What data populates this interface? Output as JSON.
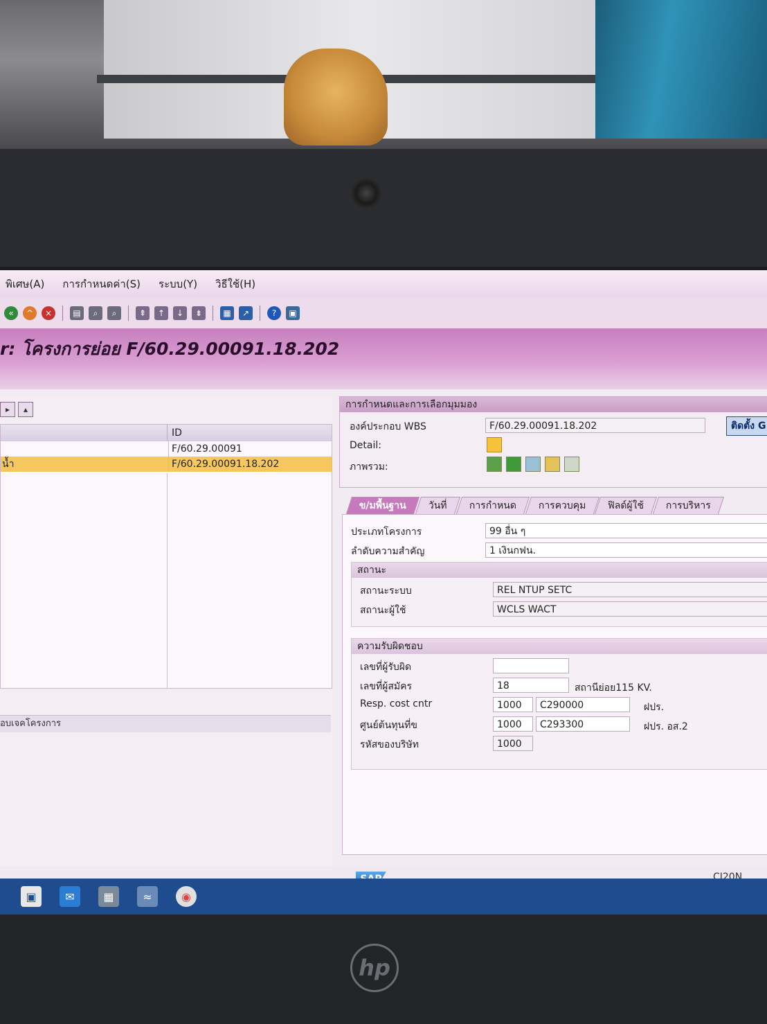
{
  "menu": {
    "items": [
      "พิเศษ(A)",
      "การกำหนดค่า(S)",
      "ระบบ(Y)",
      "วิธีใช้(H)"
    ]
  },
  "toolbar": {
    "icons": [
      "back-icon",
      "exit-icon",
      "cancel-icon",
      "print-icon",
      "find-icon",
      "find-next-icon",
      "first-page-icon",
      "prev-page-icon",
      "next-page-icon",
      "last-page-icon",
      "create-session-icon",
      "shortcut-icon",
      "help-icon",
      "layout-icon"
    ]
  },
  "title": {
    "text": "r: โครงการย่อย F/60.29.00091.18.202"
  },
  "tree": {
    "header_id": "ID",
    "rows": [
      {
        "name": "",
        "id": "F/60.29.00091"
      },
      {
        "name": "น้ำ",
        "id": "F/60.29.00091.18.202"
      }
    ],
    "bottom_label": "อบเจคโครงการ"
  },
  "details": {
    "section_title": "การกำหนดและการเลือกมุมมอง",
    "wbs_label": "องค์ประกอบ WBS",
    "wbs_value": "F/60.29.00091.18.202",
    "settings_button": "ติดตั้ง G",
    "detail_label": "Detail:",
    "overview_label": "ภาพรวม:"
  },
  "tabs": [
    "ข/มพื้นฐาน",
    "วันที่",
    "การกำหนด",
    "การควบคุม",
    "ฟิลด์ผู้ใช้",
    "การบริหาร"
  ],
  "basic": {
    "project_type_label": "ประเภทโครงการ",
    "project_type_value": "99 อื่น ๆ",
    "priority_label": "ลำดับความสำคัญ",
    "priority_value": "1 เงินกฟน."
  },
  "status": {
    "section_title": "สถานะ",
    "system_label": "สถานะระบบ",
    "system_value": "REL  NTUP SETC",
    "user_label": "สถานะผู้ใช้",
    "user_value": "WCLS WACT"
  },
  "resp": {
    "section_title": "ความรับผิดชอบ",
    "responsible_label": "เลขที่ผู้รับผิด",
    "responsible_value": "",
    "applicant_label": "เลขที่ผู้สมัคร",
    "applicant_value": "18",
    "applicant_text": "สถานีย่อย115 KV.",
    "resp_cc_label": "Resp. cost cntr",
    "resp_cc_area": "1000",
    "resp_cc_value": "C290000",
    "resp_cc_text": "ฝปร.",
    "req_cc_label": "ศูนย์ต้นทุนที่ข",
    "req_cc_area": "1000",
    "req_cc_value": "C293300",
    "req_cc_text": "ฝปร. อส.2",
    "company_label": "รหัสของบริษัท",
    "company_value": "1000"
  },
  "statusbar": {
    "logo": "SAP",
    "transaction": "CJ20N"
  },
  "colors": {
    "title_gradient": "#c780bf",
    "selected_row": "#f5c75e",
    "active_tab": "#c779bd"
  }
}
